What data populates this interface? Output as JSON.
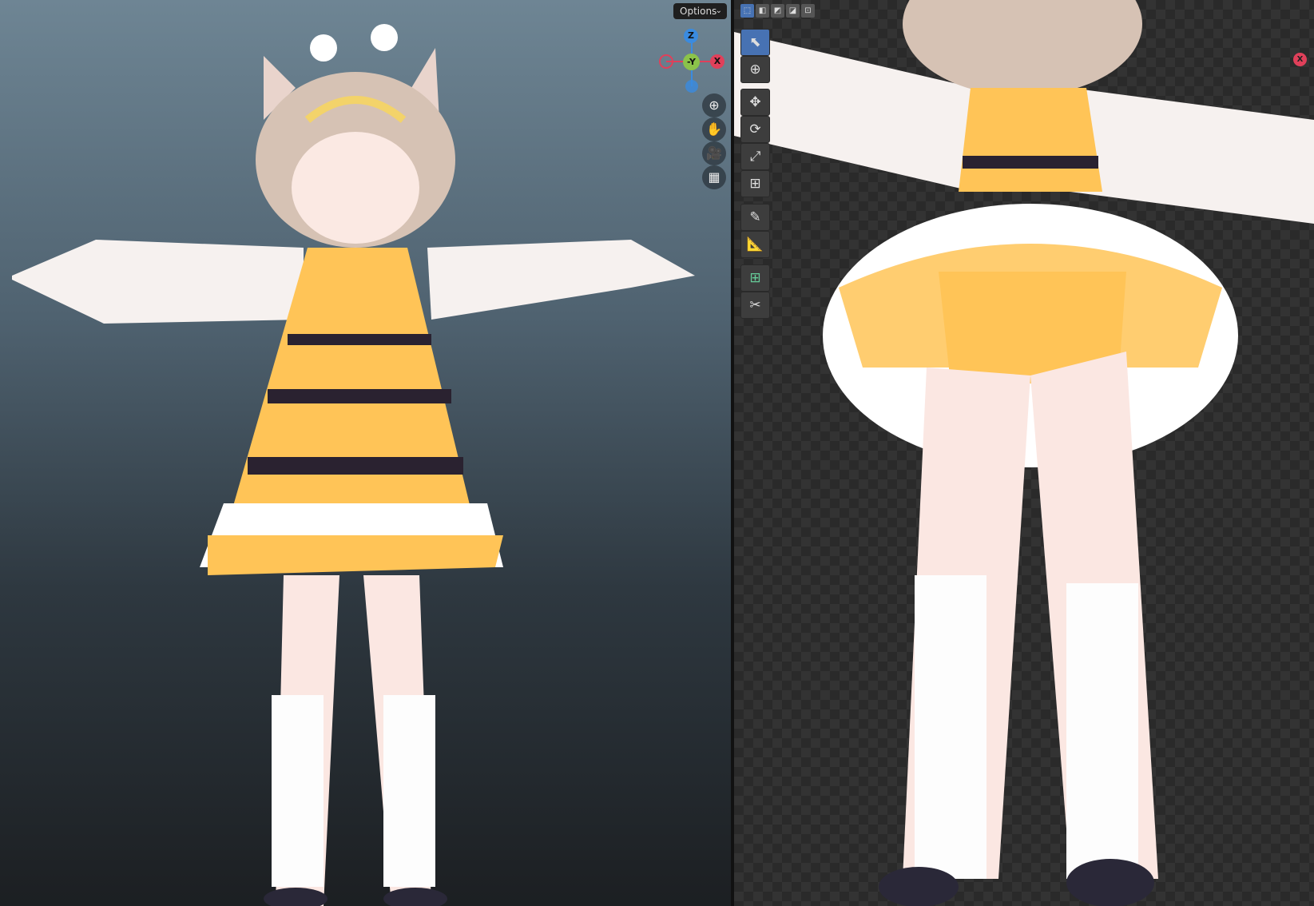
{
  "left_viewport": {
    "options_label": "Options",
    "gizmo": {
      "z": "Z",
      "neg_y": "-Y",
      "x": "X"
    },
    "nav_buttons": [
      {
        "icon": "zoom-icon",
        "glyph": "⊕"
      },
      {
        "icon": "hand-icon",
        "glyph": "✋"
      },
      {
        "icon": "camera-icon",
        "glyph": "🎥"
      },
      {
        "icon": "grid-icon",
        "glyph": "▦"
      }
    ]
  },
  "right_viewport": {
    "select_modes": [
      {
        "icon": "select-new-icon",
        "glyph": "⬚"
      },
      {
        "icon": "select-extend-icon",
        "glyph": "◧"
      },
      {
        "icon": "select-subtract-icon",
        "glyph": "◩"
      },
      {
        "icon": "select-invert-icon",
        "glyph": "◪"
      },
      {
        "icon": "select-intersect-icon",
        "glyph": "⊡"
      }
    ],
    "tools": [
      {
        "name": "select-box",
        "glyph": "⬉"
      },
      {
        "name": "cursor",
        "glyph": "⊕"
      },
      {
        "name": "move",
        "glyph": "✥"
      },
      {
        "name": "rotate",
        "glyph": "⟳"
      },
      {
        "name": "scale",
        "glyph": "⤢"
      },
      {
        "name": "transform",
        "glyph": "⊞"
      },
      {
        "name": "annotate",
        "glyph": "✎"
      },
      {
        "name": "measure",
        "glyph": "📐"
      },
      {
        "name": "add-cube",
        "glyph": "⊞"
      },
      {
        "name": "knife",
        "glyph": "✂"
      }
    ],
    "axis_x": "X"
  },
  "colors": {
    "accent": "#4772b3",
    "x_axis": "#e0405a",
    "y_axis": "#8bc34a",
    "z_axis": "#3a8be0"
  }
}
